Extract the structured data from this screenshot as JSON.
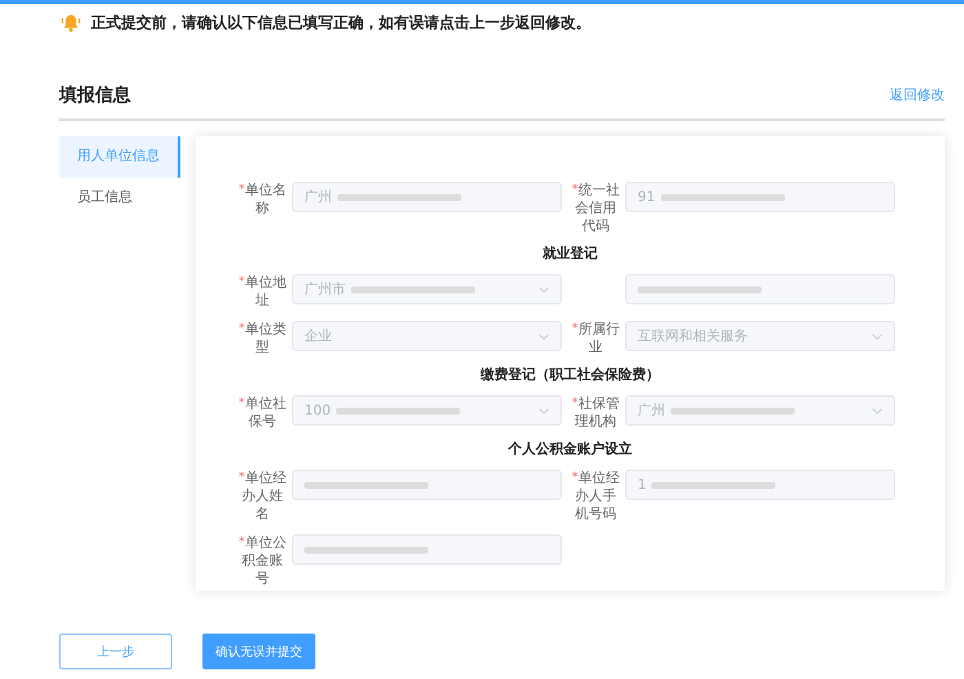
{
  "notice": "正式提交前，请确认以下信息已填写正确，如有误请点击上一步返回修改。",
  "heading": "填报信息",
  "back_link": "返回修改",
  "sidebar": {
    "items": [
      {
        "label": "用人单位信息",
        "selected": true
      },
      {
        "label": "员工信息",
        "selected": false
      }
    ]
  },
  "form": {
    "blocks": [
      {
        "kind": "row",
        "fields": [
          {
            "label": "单位名称",
            "required_mark": "*",
            "kind": "input",
            "value": "广州",
            "redacted": true
          },
          {
            "label": "统一社会信用代码",
            "required_mark": "*",
            "kind": "input",
            "value": "91",
            "redacted": true
          }
        ]
      },
      {
        "kind": "section",
        "title": "就业登记"
      },
      {
        "kind": "row",
        "fields": [
          {
            "label": "单位地址",
            "required_mark": "*",
            "kind": "select",
            "value": "广州市",
            "redacted": true
          },
          {
            "kind": "input",
            "redacted": true
          }
        ]
      },
      {
        "kind": "row",
        "fields": [
          {
            "label": "单位类型",
            "required_mark": "*",
            "kind": "select",
            "value": "企业",
            "redacted": false
          },
          {
            "label": "所属行业",
            "required_mark": "*",
            "kind": "select",
            "value": "互联网和相关服务",
            "redacted": false
          }
        ]
      },
      {
        "kind": "section",
        "title": "缴费登记（职工社会保险费）"
      },
      {
        "kind": "row",
        "fields": [
          {
            "label": "单位社保号",
            "required_mark": "*",
            "kind": "select",
            "value": "100",
            "redacted": true
          },
          {
            "label": "社保管理机构",
            "required_mark": "*",
            "kind": "select",
            "value": "广州",
            "redacted": true
          }
        ]
      },
      {
        "kind": "section",
        "title": "个人公积金账户设立"
      },
      {
        "kind": "row",
        "fields": [
          {
            "label": "单位经办人姓名",
            "required_mark": "*",
            "kind": "input",
            "redacted": true
          },
          {
            "label": "单位经办人手机号码",
            "required_mark": "*",
            "kind": "input",
            "value": "1",
            "redacted": true
          }
        ]
      },
      {
        "kind": "row",
        "fields": [
          {
            "label": "单位公积金账号",
            "required_mark": "*",
            "kind": "input",
            "redacted": true
          }
        ]
      }
    ]
  },
  "buttons": [
    {
      "label": "上一步",
      "kind": "secondary"
    },
    {
      "label": "确认无误并提交",
      "kind": "primary"
    }
  ]
}
